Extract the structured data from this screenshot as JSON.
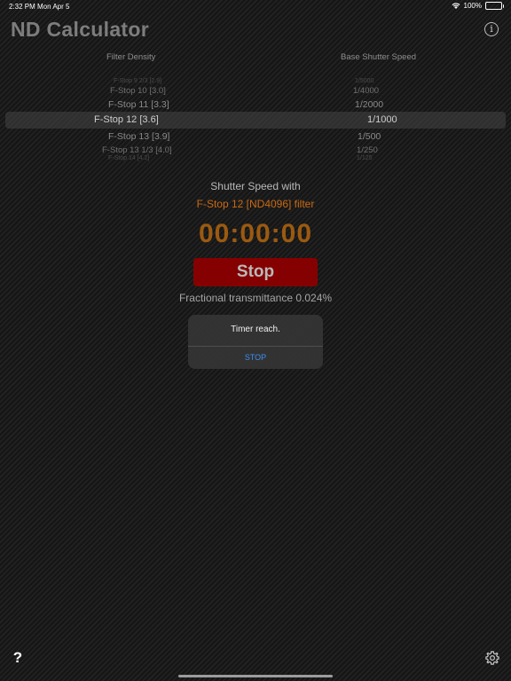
{
  "status_bar": {
    "time": "2:32 PM",
    "date": "Mon Apr 5",
    "battery": "100%"
  },
  "app_title": "ND Calculator",
  "columns": {
    "filter_density": "Filter Density",
    "base_shutter_speed": "Base Shutter Speed"
  },
  "picker": {
    "rows": [
      {
        "density": "F-Stop 9 2/3 [2.9]",
        "shutter": "1/5000"
      },
      {
        "density": "F-Stop 10 [3.0]",
        "shutter": "1/4000"
      },
      {
        "density": "F-Stop 11 [3.3]",
        "shutter": "1/2000"
      },
      {
        "density": "F-Stop 12 [3.6]",
        "shutter": "1/1000"
      },
      {
        "density": "F-Stop 13 [3.9]",
        "shutter": "1/500"
      },
      {
        "density": "F-Stop 13 1/3 [4.0]",
        "shutter": "1/250"
      },
      {
        "density": "F-Stop 14 [4.2]",
        "shutter": "1/125"
      }
    ],
    "selected_index": 3
  },
  "result": {
    "shutter_label": "Shutter Speed with",
    "filter_label": "F-Stop 12 [ND4096] filter",
    "timer": "00:00:00",
    "stop_label": "Stop",
    "transmittance": "Fractional transmittance 0.024%"
  },
  "alert": {
    "message": "Timer reach.",
    "button": "STOP",
    "button_color": "#3d8ef0"
  },
  "footer": {
    "help_label": "?"
  },
  "colors": {
    "accent_orange": "#c86a13",
    "timer_color": "#9b5a10",
    "stop_red": "#850000"
  }
}
